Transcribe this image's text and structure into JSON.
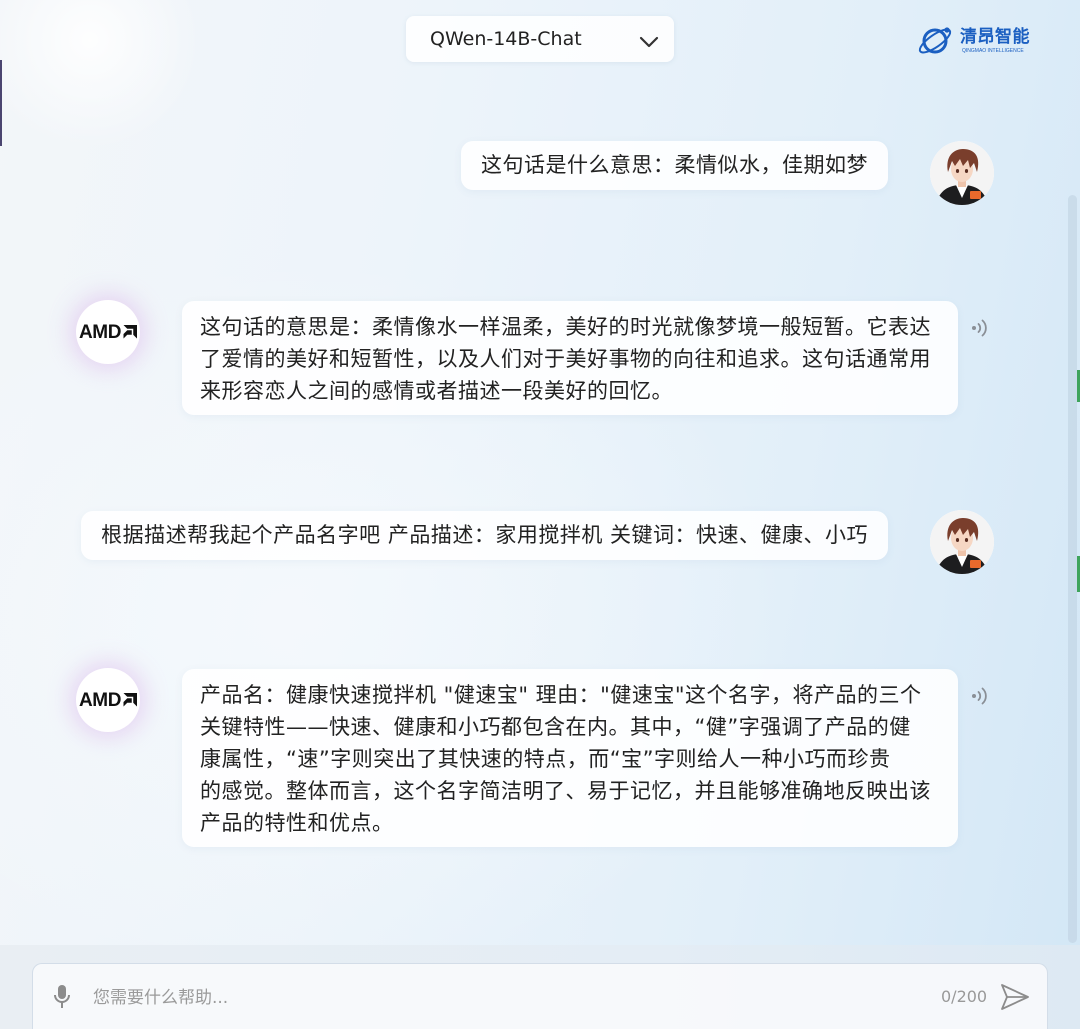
{
  "header": {
    "model_selector": {
      "selected": "QWen-14B-Chat",
      "icon": "chevron-down-icon"
    },
    "logo": {
      "name": "清昂智能",
      "subtitle": "QINGMAO INTELLIGENCE",
      "icon": "orbit-logo-icon"
    }
  },
  "messages": [
    {
      "text": "这句话是什么意思：柔情似水，佳期如梦",
      "avatar_icon": "user-avatar-icon"
    },
    {
      "avatar_logo": "AMD",
      "lines": [
        "这句话的意思是：柔情像水一样温柔，美好的时光就像梦境一般短暂。它表达",
        "了爱情的美好和短暂性，以及人们对于美好事物的向往和追求。这句话通常用",
        "来形容恋人之间的感情或者描述一段美好的回忆。"
      ],
      "action_icon": "speaker-icon"
    },
    {
      "text": "根据描述帮我起个产品名字吧 产品描述：家用搅拌机 关键词：快速、健康、小巧",
      "avatar_icon": "user-avatar-icon"
    },
    {
      "avatar_logo": "AMD",
      "lines": [
        "产品名：健康快速搅拌机 \"健速宝\" 理由：\"健速宝\"这个名字，将产品的三个",
        "关键特性——快速、健康和小巧都包含在内。其中，“健”字强调了产品的健",
        "康属性，“速”字则突出了其快速的特点，而“宝”字则给人一种小巧而珍贵",
        "的感觉。整体而言，这个名字简洁明了、易于记忆，并且能够准确地反映出该",
        "产品的特性和优点。"
      ],
      "action_icon": "speaker-icon"
    }
  ],
  "composer": {
    "placeholder": "您需要什么帮助...",
    "counter": "0/200",
    "left_icon": "microphone-icon",
    "send_icon": "send-icon"
  },
  "colors": {
    "brand_blue": "#1b5fc1",
    "text": "#222222",
    "muted": "#999999",
    "bubble": "#ffffff"
  }
}
